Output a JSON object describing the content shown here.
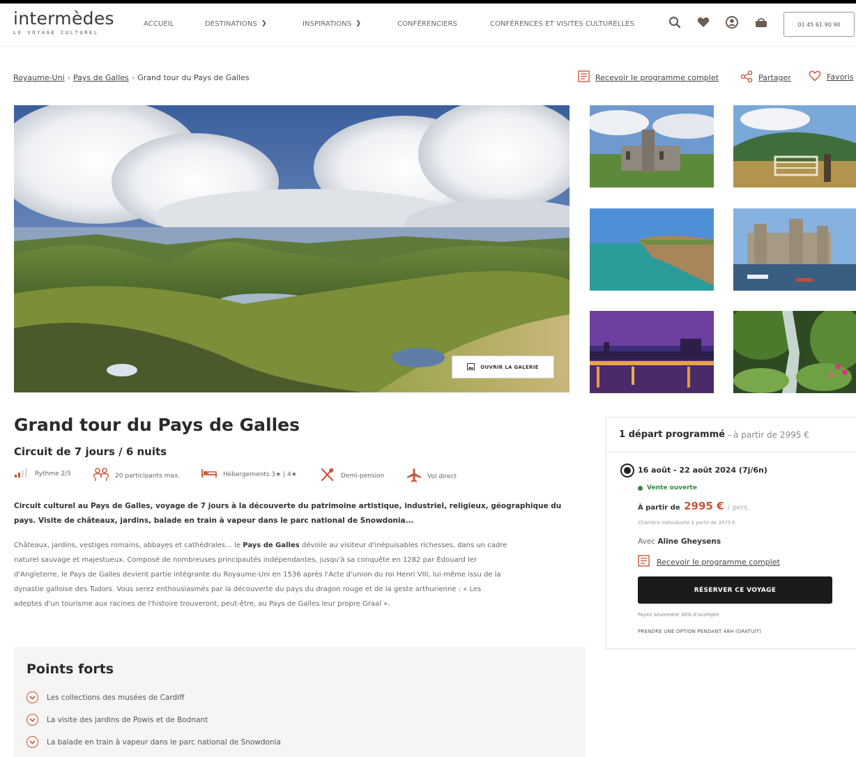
{
  "header": {
    "logo_main": "intermèdes",
    "logo_sub": "LE VOYAGE CULTUREL",
    "nav": [
      {
        "label": "ACCUEIL"
      },
      {
        "label": "DESTINATIONS"
      },
      {
        "label": "INSPIRATIONS"
      },
      {
        "label": "CONFÉRENCIERS"
      },
      {
        "label": "CONFÉRENCES ET VISITES CULTURELLES"
      }
    ],
    "phone": "01 45 61 90 90"
  },
  "breadcrumb": {
    "items": [
      "Royaume-Uni",
      "Pays de Galles"
    ],
    "current": "Grand tour du Pays de Galles"
  },
  "actions": {
    "program": "Recevoir le programme complet",
    "share": "Partager",
    "favorites": "Favoris"
  },
  "gallery": {
    "open_label": "OUVRIR LA GALERIE"
  },
  "trip": {
    "title": "Grand tour du Pays de Galles",
    "subtitle": "Circuit de 7 jours / 6 nuits",
    "features": {
      "rhythm": "Rythme 2/5",
      "participants": "20 participants max.",
      "lodging": "Hébergements 3★ | 4★",
      "meals": "Demi-pension",
      "flight": "Vol direct"
    },
    "intro_1": "Circuit culturel au Pays de Galles, voyage de 7 jours à la découverte du patrimoine artistique, industriel, religieux, géographique du",
    "intro_2": "pays. Visite de châteaux, jardins, balade en train à vapeur dans le parc national de Snowdonia...",
    "desc_1a": "Châteaux, jardins, vestiges romains, abbayes et cathédrales… le ",
    "desc_1b": "Pays de Galles",
    "desc_1c": " dévoile au visiteur d'inépuisables richesses, dans un cadre",
    "desc_2": "naturel sauvage et majestueux. Composé de nombreuses principautés indépendantes, jusqu'à sa conquête en 1282 par Édouard Ier",
    "desc_3": "d'Angleterre, le Pays de Galles devient partie intégrante du Royaume-Uni en 1536 après l'Acte d'union du roi Henri VIII, lui-même issu de la",
    "desc_4": "dynastie galloise des Tudors. Vous serez enthousiasmés par la découverte du pays du dragon rouge et de la geste arthurienne : « Les",
    "desc_5": "adeptes d'un tourisme aux racines de l'histoire trouveront, peut-être, au Pays de Galles leur propre Graal »."
  },
  "highlights": {
    "title": "Points forts",
    "items": [
      "Les collections des musées de Cardiff",
      "La visite des jardins de Powis et de Bodnant",
      "La balade en train à vapeur dans le parc national de Snowdonia"
    ]
  },
  "booking": {
    "head_bold": "1 départ programmé",
    "head_rest": "- à partir de 2995 €",
    "date": "16 août - 22 août 2024 (7j/6n)",
    "status": "Vente ouverte",
    "price_prefix": "À partir de",
    "price": "2995 €",
    "price_unit": "/ pers.",
    "single_room": "Chambre individuelle à partir de 3575 €",
    "guide_prefix": "Avec",
    "guide_name": "Aline Gheysens",
    "program": "Recevoir le programme complet",
    "reserve": "RÉSERVER CE VOYAGE",
    "deposit": "Payez seulement 30% d'acompte",
    "option": "PRENDRE UNE OPTION PENDANT 48H (GRATUIT)"
  },
  "colors": {
    "accent": "#c9573a",
    "status_green": "#2e8b3a",
    "button_dark": "#1c1a1a"
  }
}
